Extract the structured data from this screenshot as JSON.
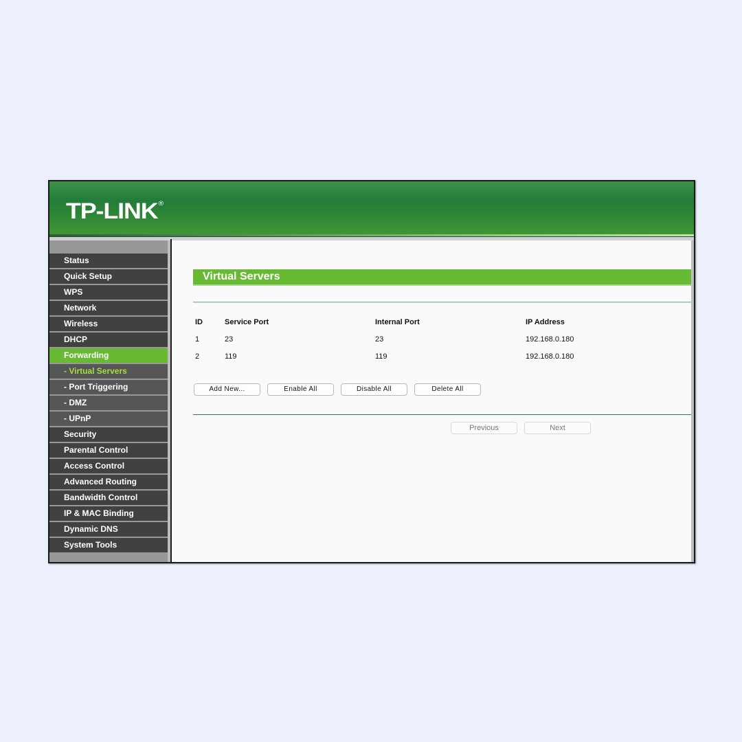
{
  "brand": {
    "logo_text": "TP-LINK",
    "registered_mark": "®",
    "accent": "#68b933",
    "banner_color": "#237c3a"
  },
  "sidebar": {
    "items": [
      {
        "label": "Status",
        "type": "main"
      },
      {
        "label": "Quick Setup",
        "type": "main"
      },
      {
        "label": "WPS",
        "type": "main"
      },
      {
        "label": "Network",
        "type": "main"
      },
      {
        "label": "Wireless",
        "type": "main"
      },
      {
        "label": "DHCP",
        "type": "main"
      },
      {
        "label": "Forwarding",
        "type": "main",
        "active": true
      },
      {
        "label": "- Virtual Servers",
        "type": "sub",
        "current": true
      },
      {
        "label": "- Port Triggering",
        "type": "sub"
      },
      {
        "label": "- DMZ",
        "type": "sub"
      },
      {
        "label": "- UPnP",
        "type": "sub"
      },
      {
        "label": "Security",
        "type": "main"
      },
      {
        "label": "Parental Control",
        "type": "main"
      },
      {
        "label": "Access Control",
        "type": "main"
      },
      {
        "label": "Advanced Routing",
        "type": "main"
      },
      {
        "label": "Bandwidth Control",
        "type": "main"
      },
      {
        "label": "IP & MAC Binding",
        "type": "main"
      },
      {
        "label": "Dynamic DNS",
        "type": "main"
      },
      {
        "label": "System Tools",
        "type": "main"
      }
    ]
  },
  "main": {
    "title": "Virtual Servers",
    "table": {
      "headers": [
        "ID",
        "Service Port",
        "Internal Port",
        "IP Address"
      ],
      "rows": [
        {
          "id": "1",
          "service_port": "23",
          "internal_port": "23",
          "ip": "192.168.0.180"
        },
        {
          "id": "2",
          "service_port": "119",
          "internal_port": "119",
          "ip": "192.168.0.180"
        }
      ]
    },
    "buttons": {
      "add_new": "Add New...",
      "enable_all": "Enable All",
      "disable_all": "Disable All",
      "delete_all": "Delete All"
    },
    "pager": {
      "previous": "Previous",
      "next": "Next"
    }
  }
}
